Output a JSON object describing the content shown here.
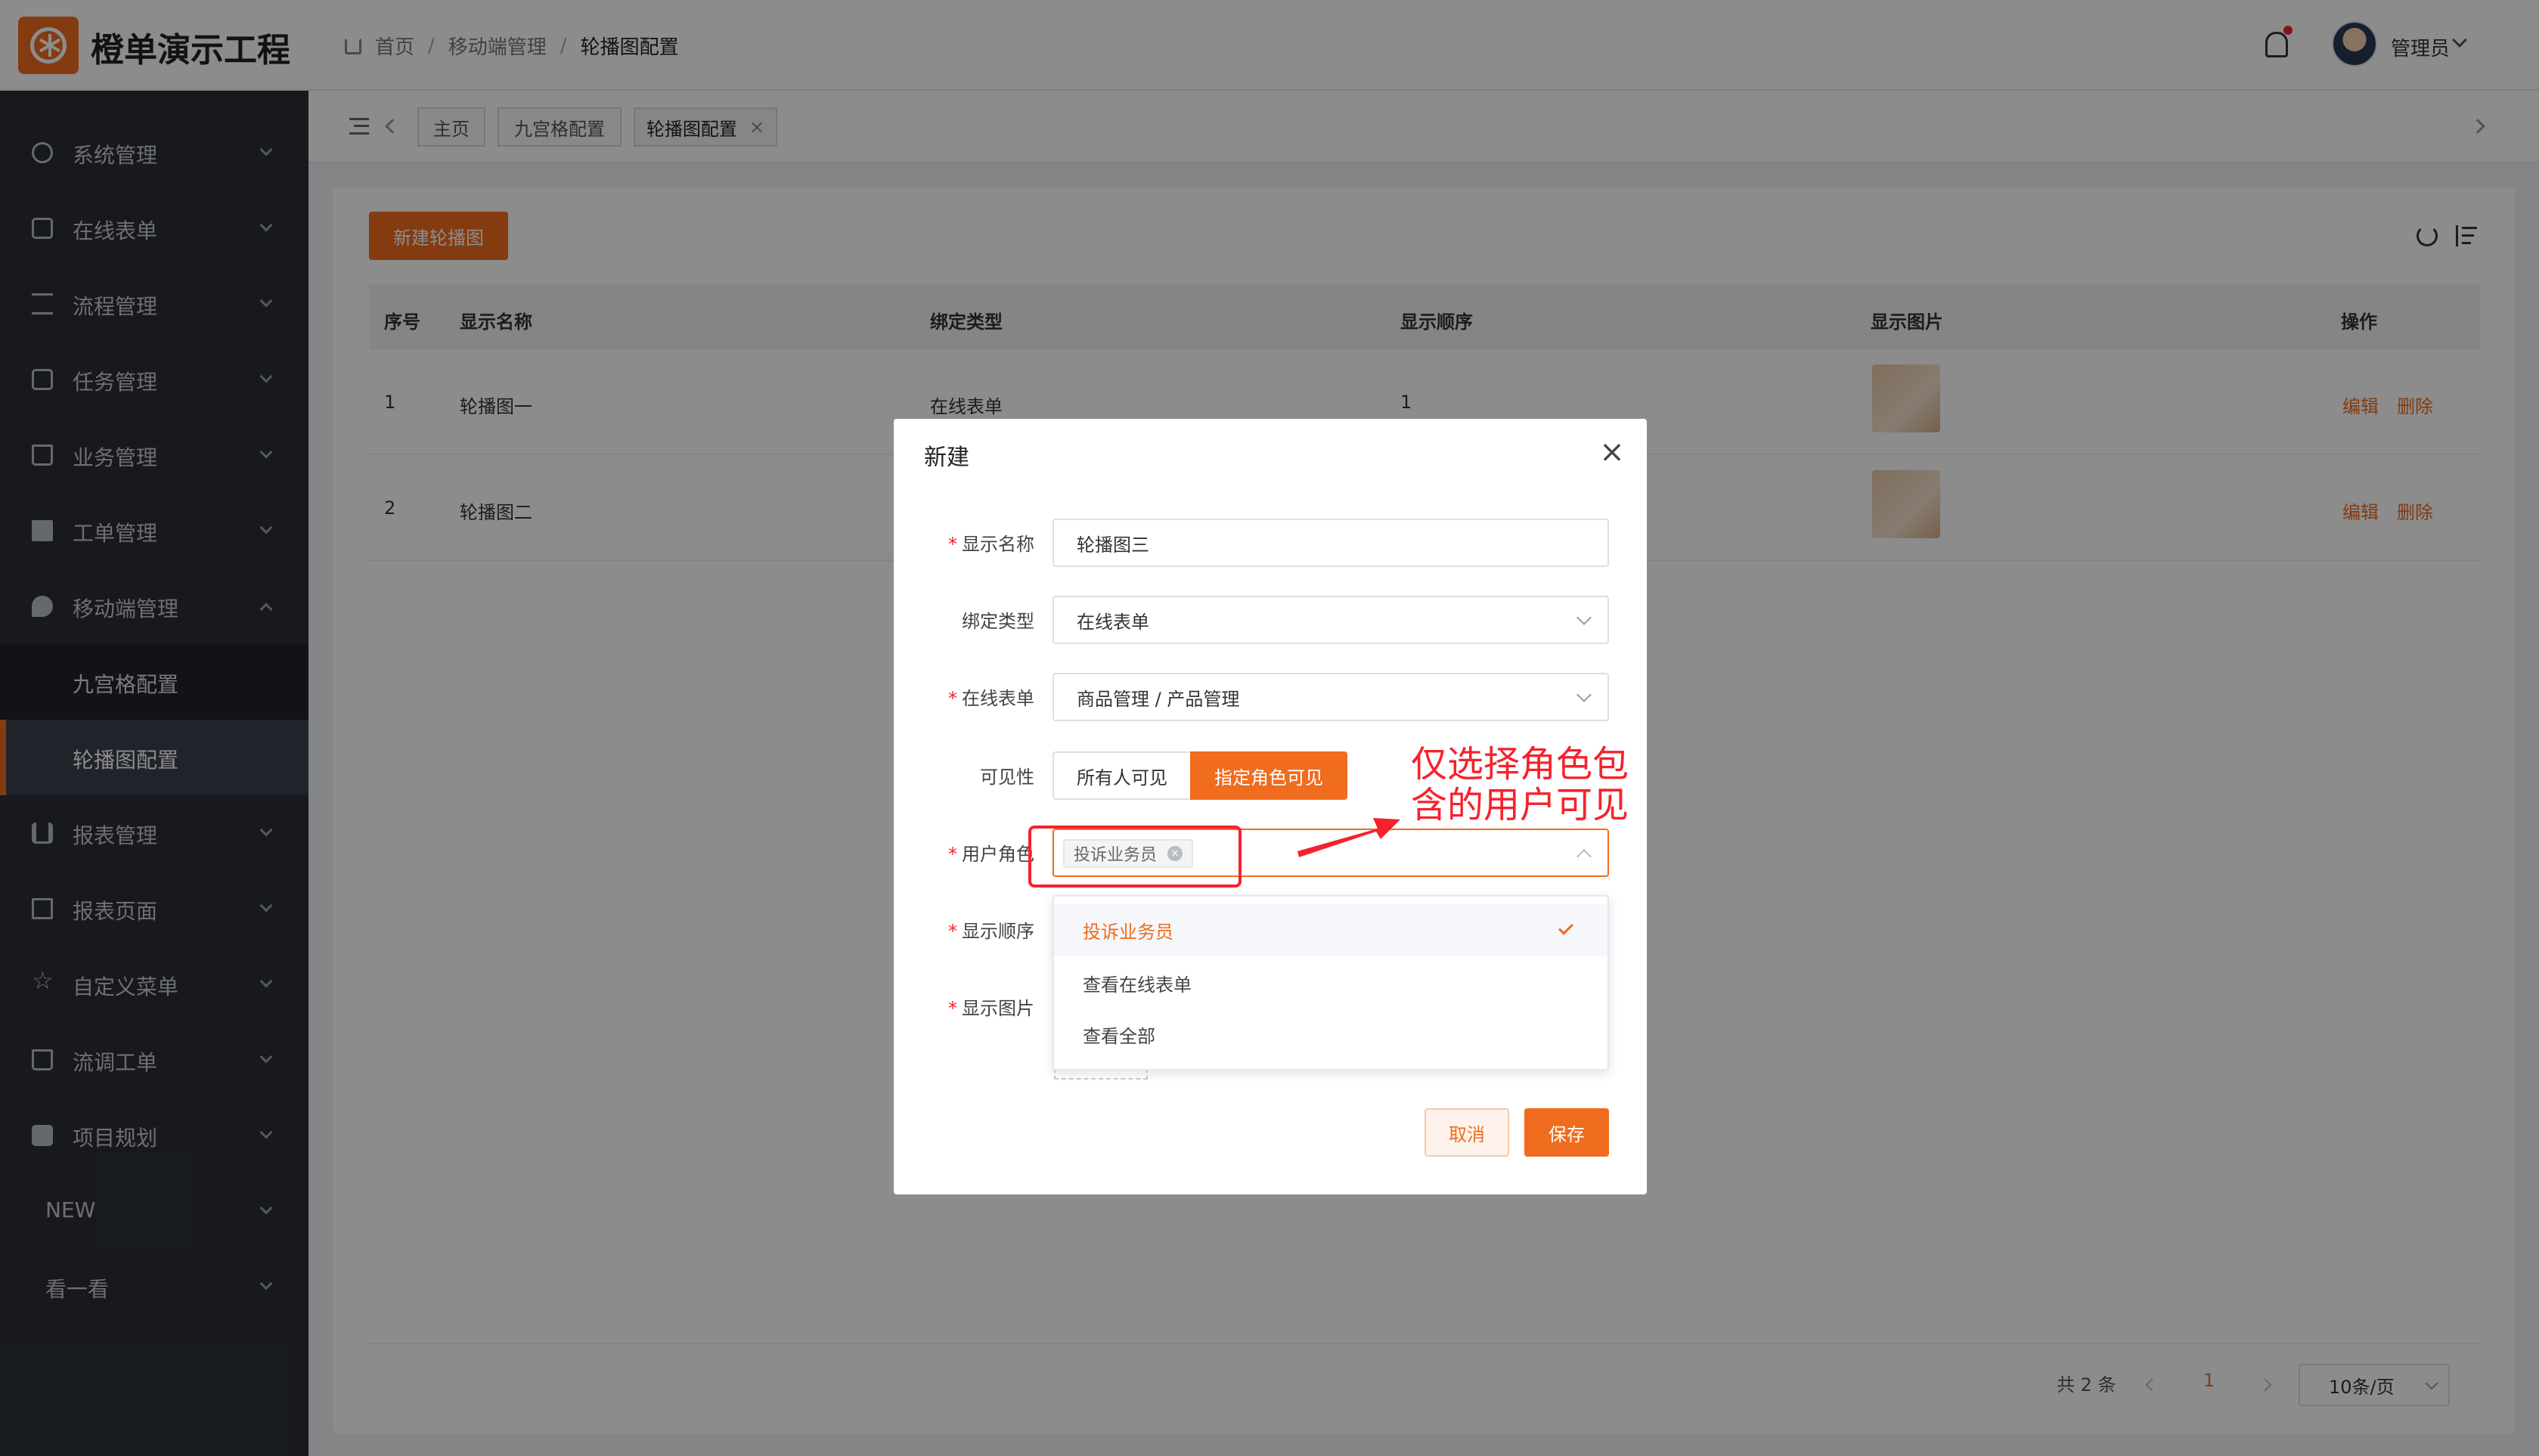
{
  "app": {
    "title": "橙单演示工程"
  },
  "breadcrumb": {
    "items": [
      "首页",
      "移动端管理",
      "轮播图配置"
    ]
  },
  "header": {
    "user_name": "管理员"
  },
  "sidebar": {
    "items": [
      {
        "label": "系统管理"
      },
      {
        "label": "在线表单"
      },
      {
        "label": "流程管理"
      },
      {
        "label": "任务管理"
      },
      {
        "label": "业务管理"
      },
      {
        "label": "工单管理"
      },
      {
        "label": "移动端管理"
      },
      {
        "label": "报表管理"
      },
      {
        "label": "报表页面"
      },
      {
        "label": "自定义菜单"
      },
      {
        "label": "流调工单"
      },
      {
        "label": "项目规划"
      },
      {
        "label": "NEW"
      },
      {
        "label": "看一看"
      }
    ],
    "sub_items": [
      {
        "label": "九宫格配置"
      },
      {
        "label": "轮播图配置"
      }
    ]
  },
  "tabs": [
    {
      "label": "主页"
    },
    {
      "label": "九宫格配置"
    },
    {
      "label": "轮播图配置"
    }
  ],
  "toolbar": {
    "new_label": "新建轮播图"
  },
  "table": {
    "columns": [
      "序号",
      "显示名称",
      "绑定类型",
      "显示顺序",
      "显示图片",
      "操作"
    ],
    "rows": [
      {
        "index": "1",
        "name": "轮播图一",
        "type": "在线表单",
        "order": "1"
      },
      {
        "index": "2",
        "name": "轮播图二"
      }
    ],
    "edit_label": "编辑",
    "delete_label": "删除"
  },
  "pagination": {
    "total": "共 2 条",
    "current": "1",
    "page_size": "10条/页"
  },
  "dialog": {
    "title": "新建",
    "fields": {
      "name_label": "显示名称",
      "name_value": "轮播图三",
      "type_label": "绑定类型",
      "type_value": "在线表单",
      "form_label": "在线表单",
      "form_value": "商品管理 / 产品管理",
      "visibility_label": "可见性",
      "visibility_all": "所有人可见",
      "visibility_role": "指定角色可见",
      "role_label": "用户角色",
      "role_tag": "投诉业务员",
      "order_label": "显示顺序",
      "image_label": "显示图片"
    },
    "dropdown_options": [
      "投诉业务员",
      "查看在线表单",
      "查看全部"
    ],
    "cancel_label": "取消",
    "save_label": "保存"
  },
  "annotation": {
    "text": "仅选择角色包含的用户可见"
  },
  "colors": {
    "accent": "#f06c1e",
    "sidebar_bg": "#2a2f39",
    "annotation": "#f5222d"
  }
}
